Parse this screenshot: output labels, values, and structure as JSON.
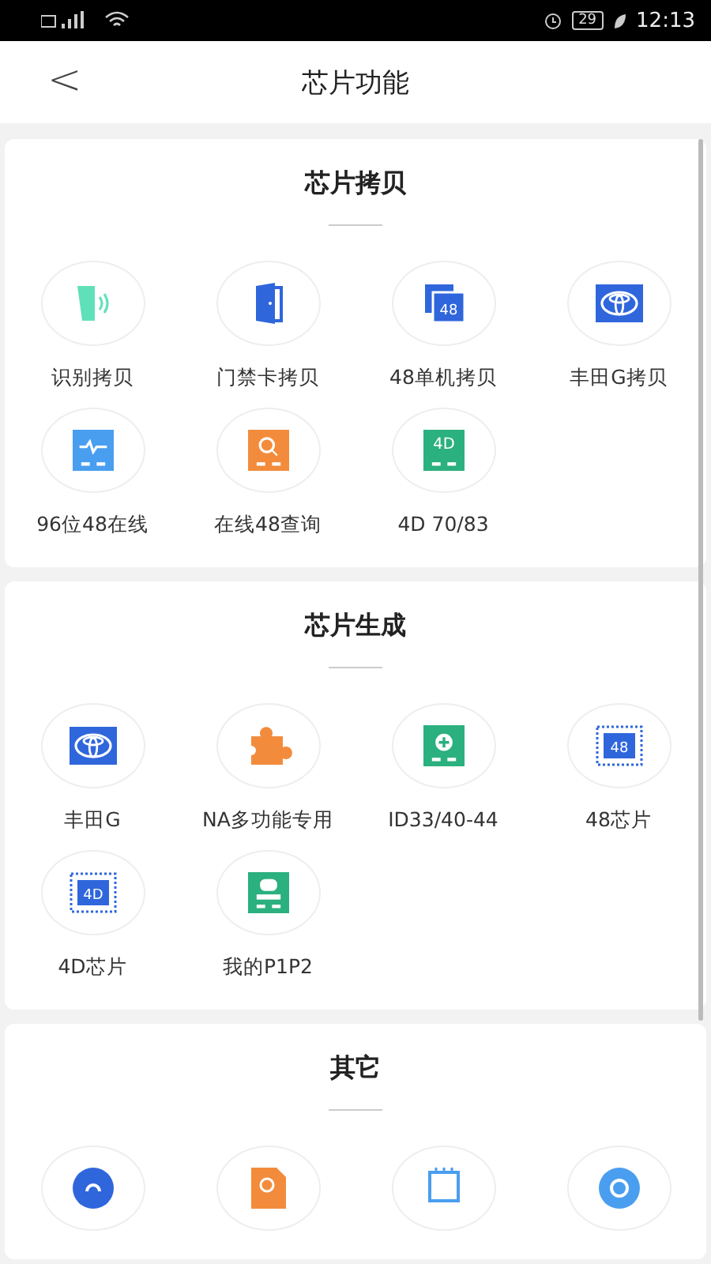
{
  "status_bar": {
    "battery": "29",
    "time": "12:13"
  },
  "header": {
    "back": "<",
    "title": "芯片功能"
  },
  "sections": [
    {
      "title": "芯片拷贝",
      "items": [
        {
          "label": "识别拷贝",
          "kind": "nfc-card"
        },
        {
          "label": "门禁卡拷贝",
          "kind": "door"
        },
        {
          "label": "48单机拷贝",
          "kind": "stacked-card",
          "badge": "48"
        },
        {
          "label": "丰田G拷贝",
          "kind": "emblem"
        },
        {
          "label": "96位48在线",
          "kind": "wave-card"
        },
        {
          "label": "在线48查询",
          "kind": "search-card"
        },
        {
          "label": "4D 70/83",
          "kind": "text-card",
          "badge": "4D"
        }
      ]
    },
    {
      "title": "芯片生成",
      "items": [
        {
          "label": "丰田G",
          "kind": "emblem"
        },
        {
          "label": "NA多功能专用",
          "kind": "puzzle"
        },
        {
          "label": "ID33/40-44",
          "kind": "plus-card"
        },
        {
          "label": "48芯片",
          "kind": "chip",
          "badge": "48"
        },
        {
          "label": "4D芯片",
          "kind": "chip",
          "badge": "4D"
        },
        {
          "label": "我的P1P2",
          "kind": "person-card"
        }
      ]
    },
    {
      "title": "其它",
      "items": [
        {
          "kind": "blue-round"
        },
        {
          "kind": "orange-doc"
        },
        {
          "kind": "chip-outline"
        },
        {
          "kind": "light-round"
        }
      ]
    }
  ]
}
